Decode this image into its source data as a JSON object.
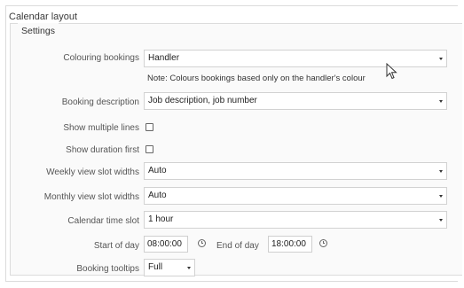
{
  "panel": {
    "title": "Calendar layout",
    "group_title": "Settings"
  },
  "colouring_bookings": {
    "label": "Colouring bookings",
    "value": "Handler",
    "note": "Note: Colours bookings based only on the handler's colour"
  },
  "booking_description": {
    "label": "Booking description",
    "value": "Job description, job number"
  },
  "show_multiple_lines": {
    "label": "Show multiple lines",
    "checked": false
  },
  "show_duration_first": {
    "label": "Show duration first",
    "checked": false
  },
  "weekly_view_slot_widths": {
    "label": "Weekly view slot widths",
    "value": "Auto"
  },
  "monthly_view_slot_widths": {
    "label": "Monthly view slot widths",
    "value": "Auto"
  },
  "calendar_time_slot": {
    "label": "Calendar time slot",
    "value": "1 hour"
  },
  "start_of_day": {
    "label": "Start of day",
    "value": "08:00:00"
  },
  "end_of_day": {
    "label": "End of day",
    "value": "18:00:00"
  },
  "booking_tooltips": {
    "label": "Booking tooltips",
    "value": "Full"
  }
}
